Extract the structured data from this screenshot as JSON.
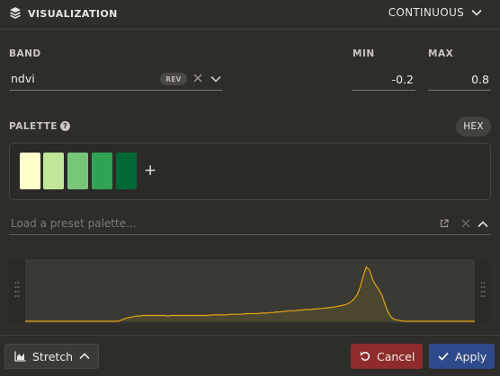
{
  "header": {
    "title": "VISUALIZATION",
    "mode_label": "CONTINUOUS",
    "icon": "layers-icon"
  },
  "band": {
    "label": "BAND",
    "value": "ndvi",
    "rev_label": "REV"
  },
  "min": {
    "label": "MIN",
    "value": "-0.2"
  },
  "max": {
    "label": "MAX",
    "value": "0.8"
  },
  "palette": {
    "label": "PALETTE",
    "hex_label": "HEX",
    "add_label": "+",
    "colors": [
      "#ffffcc",
      "#c2e699",
      "#78c679",
      "#31a354",
      "#006837"
    ],
    "preset_placeholder": "Load a preset palette..."
  },
  "histogram": {
    "fill_color": "#4c4731",
    "line_color": "#e0a415",
    "values": [
      0,
      0,
      0,
      0,
      0,
      0,
      0,
      0,
      0,
      0,
      0,
      0,
      0,
      0,
      0,
      0,
      0,
      0,
      0,
      0,
      0,
      0,
      0,
      0,
      0,
      0,
      0,
      0,
      0,
      0,
      0,
      0.02,
      0.04,
      0.06,
      0.07,
      0.08,
      0.09,
      0.09,
      0.1,
      0.1,
      0.1,
      0.1,
      0.1,
      0.1,
      0.1,
      0.1,
      0.09,
      0.1,
      0.1,
      0.1,
      0.1,
      0.1,
      0.1,
      0.1,
      0.1,
      0.1,
      0.1,
      0.1,
      0.1,
      0.1,
      0.11,
      0.11,
      0.11,
      0.11,
      0.11,
      0.11,
      0.12,
      0.12,
      0.12,
      0.12,
      0.12,
      0.13,
      0.13,
      0.13,
      0.13,
      0.13,
      0.14,
      0.14,
      0.14,
      0.15,
      0.15,
      0.16,
      0.16,
      0.17,
      0.17,
      0.18,
      0.18,
      0.18,
      0.19,
      0.19,
      0.2,
      0.2,
      0.2,
      0.21,
      0.21,
      0.22,
      0.22,
      0.23,
      0.23,
      0.24,
      0.25,
      0.26,
      0.27,
      0.28,
      0.3,
      0.33,
      0.38,
      0.45,
      0.58,
      0.78,
      0.93,
      0.88,
      0.72,
      0.62,
      0.55,
      0.45,
      0.3,
      0.16,
      0.07,
      0.03,
      0.02,
      0.01,
      0,
      0,
      0,
      0,
      0,
      0,
      0,
      0,
      0,
      0,
      0,
      0,
      0,
      0,
      0,
      0,
      0,
      0,
      0,
      0,
      0,
      0,
      0,
      0
    ]
  },
  "footer": {
    "stretch_label": "Stretch",
    "cancel_label": "Cancel",
    "apply_label": "Apply"
  }
}
